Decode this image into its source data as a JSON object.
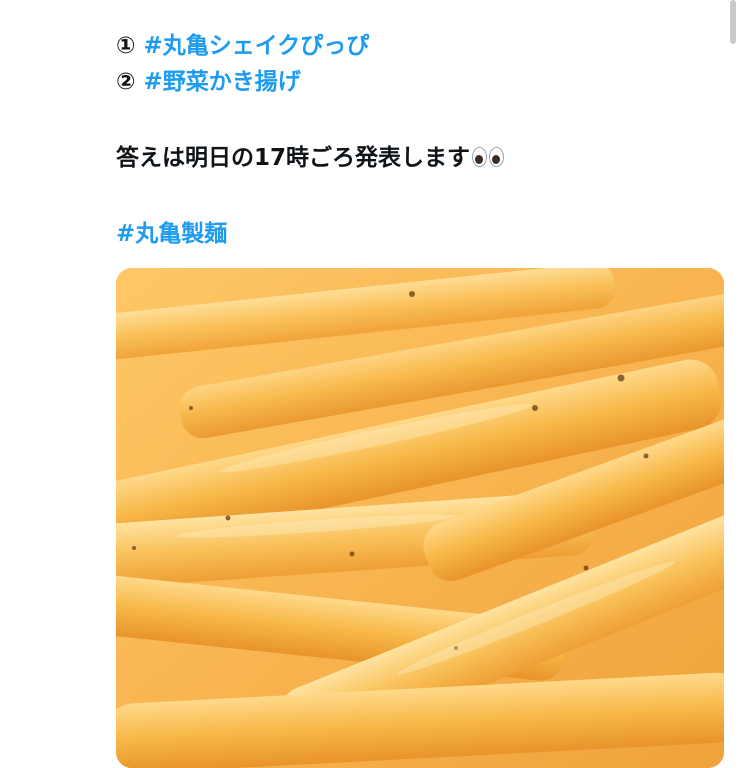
{
  "tweet": {
    "option1_prefix": "① ",
    "option1_hashtag": "#丸亀シェイクぴっぴ",
    "option2_prefix": "② ",
    "option2_hashtag": "#野菜かき揚げ",
    "answer_text": "答えは明日の17時ごろ発表します",
    "emoji": "eyes-emoji",
    "hashtag_brand": "#丸亀製麺",
    "hashtag_color": "#1d9bf0",
    "text_color": "#0f1419"
  },
  "media": {
    "icon": "fries-photo",
    "colors": {
      "base": "#f6b94a",
      "highlight": "#ffd98a",
      "shadow": "#e8942a"
    }
  }
}
